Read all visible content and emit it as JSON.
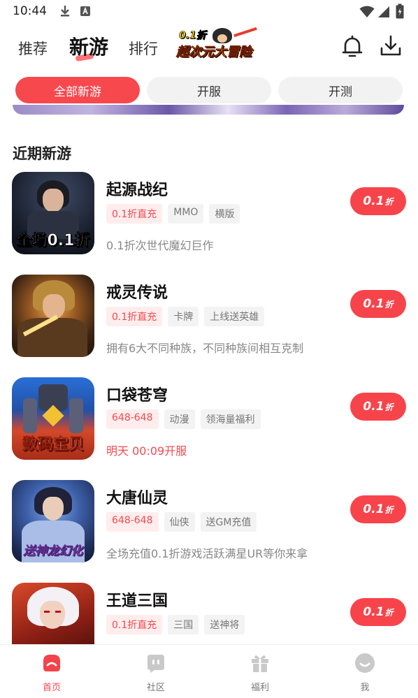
{
  "status_bar": {
    "time": "10:44"
  },
  "top_nav": {
    "tabs": [
      {
        "label": "推荐",
        "active": false
      },
      {
        "label": "新游",
        "active": true
      },
      {
        "label": "排行",
        "active": false
      }
    ],
    "banner_logo": {
      "badge": "0.1折",
      "title": "超次元大冒险"
    }
  },
  "filters": [
    {
      "label": "全部新游",
      "active": true
    },
    {
      "label": "开服",
      "active": false
    },
    {
      "label": "开测",
      "active": false
    }
  ],
  "section_title": "近期新游",
  "games": [
    {
      "name": "起源战纪",
      "thumb_text": "全场0.1折",
      "tags": [
        {
          "text": "0.1折直充",
          "hot": true
        },
        {
          "text": "MMO",
          "hot": false
        },
        {
          "text": "横版",
          "hot": false
        }
      ],
      "desc": "0.1折次世代魔幻巨作",
      "desc_open": false,
      "discount": "0.1",
      "discount_unit": "折"
    },
    {
      "name": "戒灵传说",
      "thumb_text": "",
      "tags": [
        {
          "text": "0.1折直充",
          "hot": true
        },
        {
          "text": "卡牌",
          "hot": false
        },
        {
          "text": "上线送英雄",
          "hot": false
        }
      ],
      "desc": "拥有6大不同种族，不同种族间相互克制",
      "desc_open": false,
      "discount": "0.1",
      "discount_unit": "折"
    },
    {
      "name": "口袋苍穹",
      "thumb_text": "数码宝贝",
      "tags": [
        {
          "text": "648-648",
          "hot": true
        },
        {
          "text": "动漫",
          "hot": false
        },
        {
          "text": "领海量福利",
          "hot": false
        }
      ],
      "desc": "明天 00:09开服",
      "desc_open": true,
      "discount": "0.1",
      "discount_unit": "折"
    },
    {
      "name": "大唐仙灵",
      "thumb_text": "送神龙幻化",
      "tags": [
        {
          "text": "648-648",
          "hot": true
        },
        {
          "text": "仙侠",
          "hot": false
        },
        {
          "text": "送GM充值",
          "hot": false
        }
      ],
      "desc": "全场充值0.1折游戏活跃满星UR等你来拿",
      "desc_open": false,
      "discount": "0.1",
      "discount_unit": "折"
    },
    {
      "name": "王道三国",
      "thumb_text": "",
      "tags": [
        {
          "text": "0.1折直充",
          "hot": true
        },
        {
          "text": "三国",
          "hot": false
        },
        {
          "text": "送神将",
          "hot": false
        }
      ],
      "desc": "",
      "desc_open": false,
      "discount": "0.1",
      "discount_unit": "折"
    }
  ],
  "bottom_nav": [
    {
      "label": "首页",
      "icon": "home-icon",
      "active": true
    },
    {
      "label": "社区",
      "icon": "community-icon",
      "active": false
    },
    {
      "label": "福利",
      "icon": "gift-icon",
      "active": false
    },
    {
      "label": "我",
      "icon": "profile-icon",
      "active": false
    }
  ],
  "colors": {
    "accent": "#f7484e",
    "tag_hot_bg": "#ffeded",
    "tag_bg": "#f3f3f3",
    "text_muted": "#888888"
  }
}
